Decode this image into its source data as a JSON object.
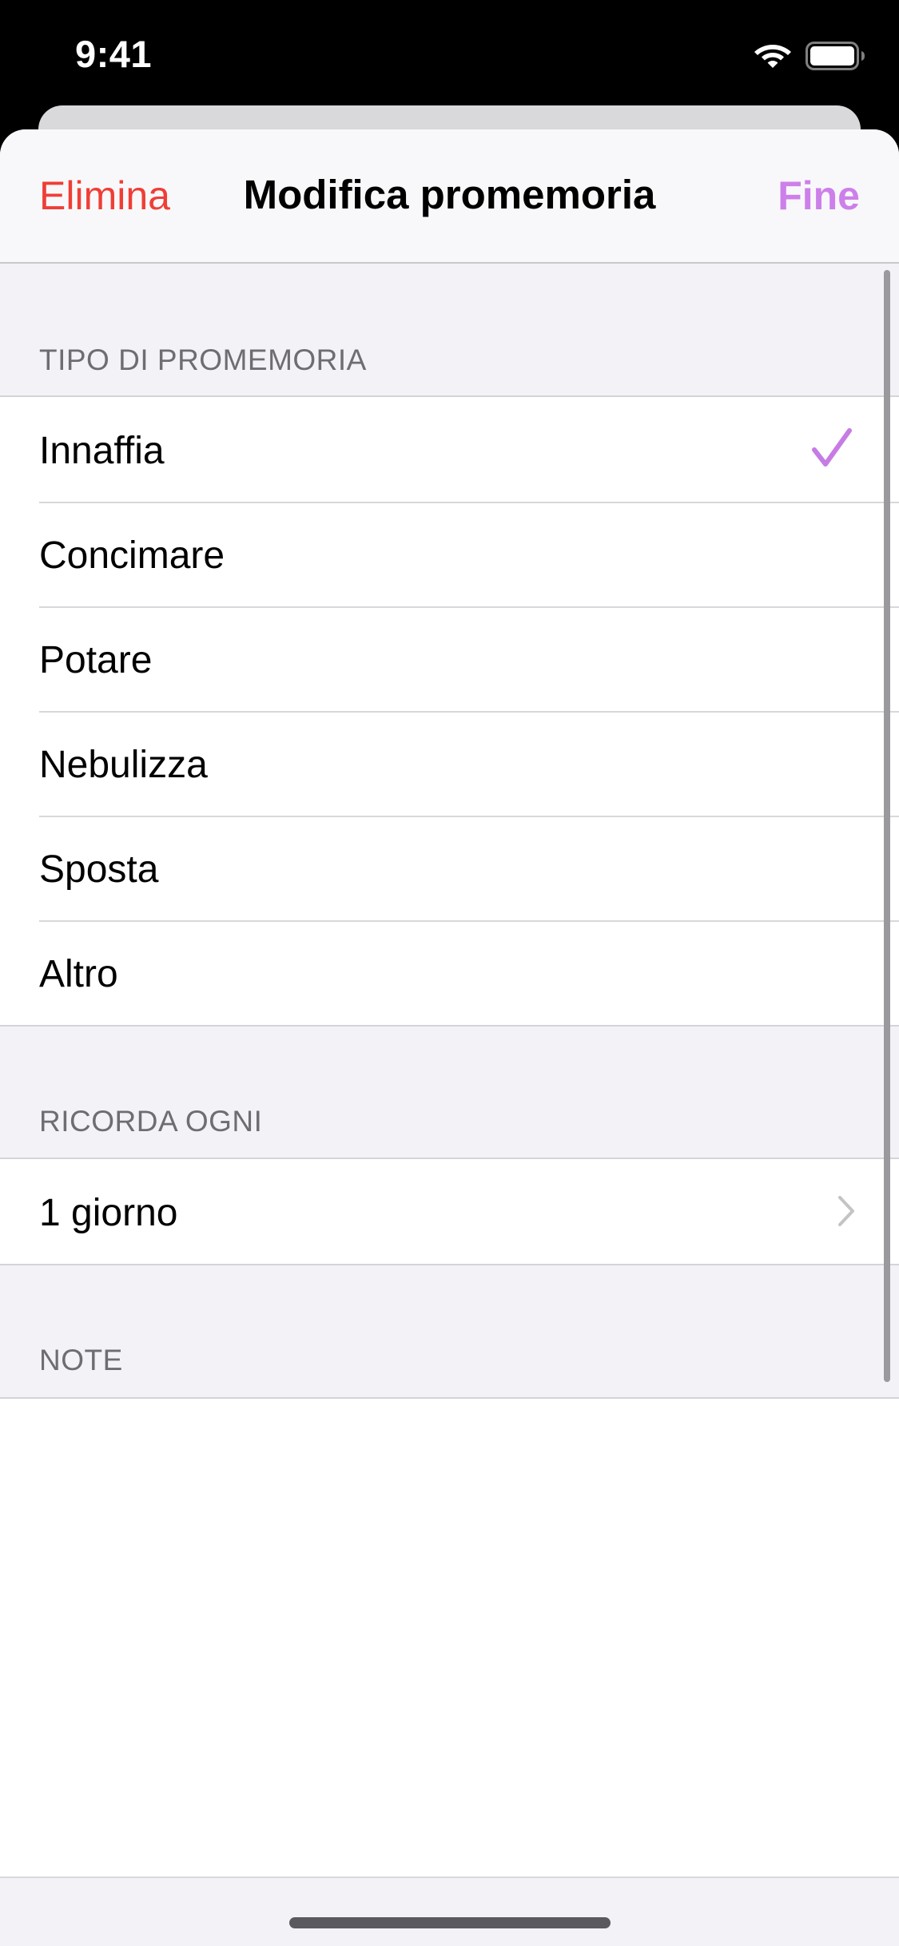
{
  "status_bar": {
    "time": "9:41",
    "icons": [
      "wifi-icon",
      "battery-icon"
    ]
  },
  "nav": {
    "left_label": "Elimina",
    "title": "Modifica promemoria",
    "right_label": "Fine"
  },
  "sections": {
    "type_header": "TIPO DI PROMEMORIA",
    "types": [
      {
        "label": "Innaffia",
        "selected": true
      },
      {
        "label": "Concimare",
        "selected": false
      },
      {
        "label": "Potare",
        "selected": false
      },
      {
        "label": "Nebulizza",
        "selected": false
      },
      {
        "label": "Sposta",
        "selected": false
      },
      {
        "label": "Altro",
        "selected": false
      }
    ],
    "repeat_header": "RICORDA OGNI",
    "repeat_value": "1 giorno",
    "notes_header": "NOTE"
  },
  "colors": {
    "destructive": "#ef3e36",
    "accent": "#cd7fea",
    "checkmark": "#c77be4"
  }
}
